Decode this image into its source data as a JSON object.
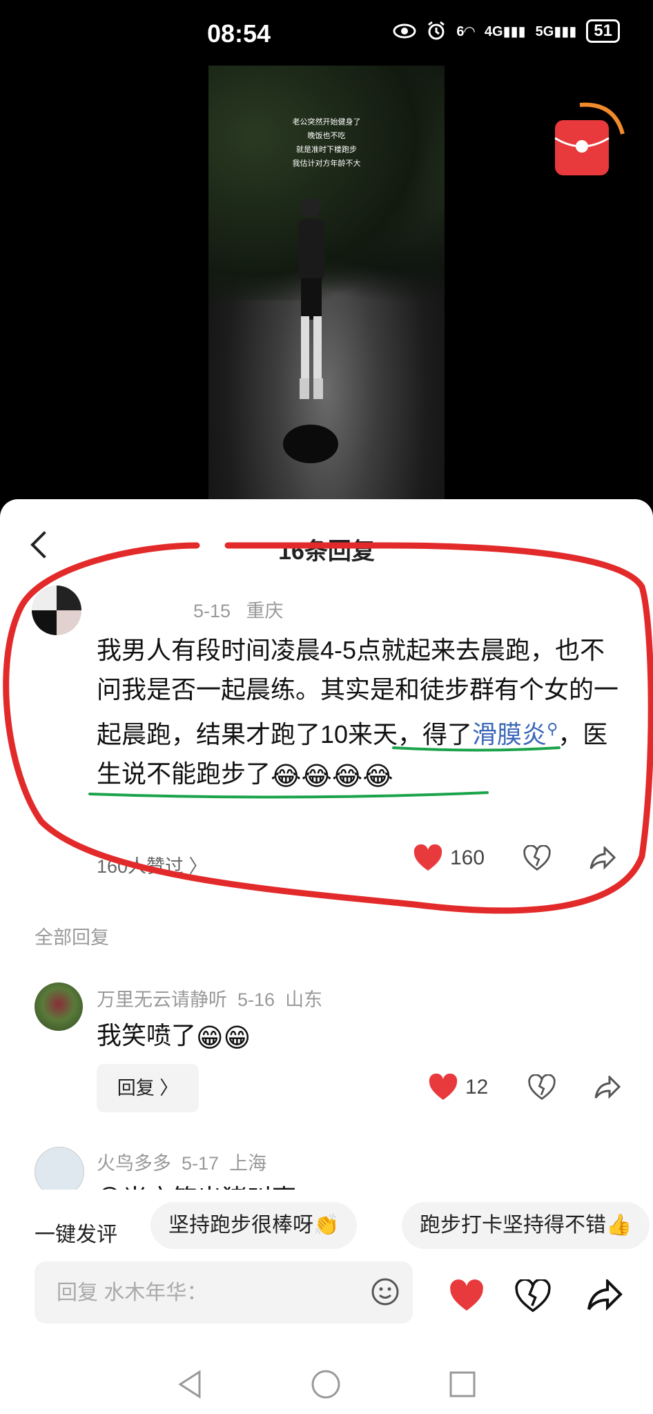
{
  "status_bar": {
    "time": "08:54",
    "net_6": "6",
    "net_4g": "4G",
    "net_5g": "5G",
    "battery": "51"
  },
  "video": {
    "caption_lines": [
      "老公突然开始健身了",
      "晚饭也不吃",
      "就是准时下楼跑步",
      "我估计对方年龄不大"
    ]
  },
  "sheet": {
    "title": "16条回复"
  },
  "post": {
    "date": "5-15",
    "location": "重庆",
    "text_a": "我男人有段时间凌晨4-5点就起来去晨跑，也不问我是否一起晨练。其实是和徒步群有个女的一起晨跑，结果才跑了10来天，得了",
    "link": "滑膜炎",
    "text_b": "，医生说不能跑步了",
    "emojis": "😂😂😂😂",
    "likes_summary": "160人赞过 〉",
    "like_count": "160"
  },
  "all_replies_label": "全部回复",
  "replies": [
    {
      "name": "万里无云请静听",
      "date": "5-16",
      "location": "山东",
      "text": "我笑喷了",
      "emojis": "😁😁",
      "reply_label": "回复 〉",
      "like_count": "12"
    },
    {
      "name": "火鸟多多",
      "date": "5-17",
      "location": "上海",
      "text": "😅当方笑出猪叫声"
    }
  ],
  "quick_comment": {
    "label": "一键发评",
    "chips": [
      "坚持跑步很棒呀👏",
      "跑步打卡坚持得不错👍"
    ]
  },
  "input": {
    "placeholder": "回复 水木年华："
  },
  "colors": {
    "like_red": "#e8393c",
    "link_blue": "#3a67b8",
    "annotation_red": "#e32a2a",
    "annotation_green": "#1aa34a"
  }
}
